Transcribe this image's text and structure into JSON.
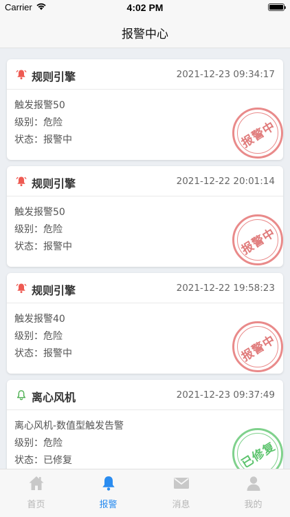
{
  "status_bar": {
    "carrier": "Carrier",
    "time": "4:02 PM"
  },
  "nav": {
    "title": "报警中心"
  },
  "alarms": [
    {
      "name": "规则引擎",
      "time": "2021-12-23 09:34:17",
      "desc": "触发报警50",
      "level": "级别：危险",
      "state": "状态：报警中",
      "stamp": "报警中",
      "stamp_color": "#e07b7b",
      "bell_color": "#ee5a52"
    },
    {
      "name": "规则引擎",
      "time": "2021-12-22 20:01:14",
      "desc": "触发报警50",
      "level": "级别：危险",
      "state": "状态：报警中",
      "stamp": "报警中",
      "stamp_color": "#e07b7b",
      "bell_color": "#ee5a52"
    },
    {
      "name": "规则引擎",
      "time": "2021-12-22 19:58:23",
      "desc": "触发报警40",
      "level": "级别：危险",
      "state": "状态：报警中",
      "stamp": "报警中",
      "stamp_color": "#e07b7b",
      "bell_color": "#ee5a52"
    },
    {
      "name": "离心风机",
      "time": "2021-12-23 09:37:49",
      "desc": "离心风机-数值型触发告警",
      "level": "级别：危险",
      "state": "状态：已修复",
      "stamp": "已修复",
      "stamp_color": "#5cc36d",
      "bell_color": "#4caf50"
    }
  ],
  "tabs": [
    {
      "label": "首页",
      "icon": "home-icon"
    },
    {
      "label": "报警",
      "icon": "bell-icon"
    },
    {
      "label": "消息",
      "icon": "mail-icon"
    },
    {
      "label": "我的",
      "icon": "user-icon"
    }
  ],
  "colors": {
    "accent": "#2a8cf0",
    "tab_inactive": "#b5b5b5"
  }
}
